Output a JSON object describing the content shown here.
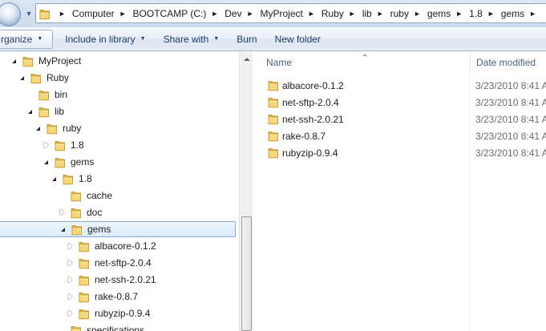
{
  "address_bar": {
    "breadcrumbs": [
      "Computer",
      "BOOTCAMP (C:)",
      "Dev",
      "MyProject",
      "Ruby",
      "lib",
      "ruby",
      "gems",
      "1.8",
      "gems"
    ]
  },
  "toolbar": {
    "organize_label": "rganize",
    "include_label": "Include in library",
    "share_label": "Share with",
    "burn_label": "Burn",
    "new_folder_label": "New folder"
  },
  "nav_tree": [
    {
      "label": "MyProject",
      "level": 1,
      "expander": "open"
    },
    {
      "label": "Ruby",
      "level": 2,
      "expander": "open"
    },
    {
      "label": "bin",
      "level": 3,
      "expander": "none"
    },
    {
      "label": "lib",
      "level": 3,
      "expander": "open"
    },
    {
      "label": "ruby",
      "level": 4,
      "expander": "open"
    },
    {
      "label": "1.8",
      "level": 5,
      "expander": "closed"
    },
    {
      "label": "gems",
      "level": 5,
      "expander": "open"
    },
    {
      "label": "1.8",
      "level": 6,
      "expander": "open"
    },
    {
      "label": "cache",
      "level": 7,
      "expander": "none"
    },
    {
      "label": "doc",
      "level": 7,
      "expander": "closed"
    },
    {
      "label": "gems",
      "level": 7,
      "expander": "open",
      "selected": true
    },
    {
      "label": "albacore-0.1.2",
      "level": 8,
      "expander": "closed"
    },
    {
      "label": "net-sftp-2.0.4",
      "level": 8,
      "expander": "closed"
    },
    {
      "label": "net-ssh-2.0.21",
      "level": 8,
      "expander": "closed"
    },
    {
      "label": "rake-0.8.7",
      "level": 8,
      "expander": "closed"
    },
    {
      "label": "rubyzip-0.9.4",
      "level": 8,
      "expander": "closed"
    },
    {
      "label": "specifications",
      "level": 7,
      "expander": "none"
    }
  ],
  "file_list": {
    "columns": {
      "name": "Name",
      "date": "Date modified"
    },
    "rows": [
      {
        "name": "albacore-0.1.2",
        "date": "3/23/2010 8:41 A"
      },
      {
        "name": "net-sftp-2.0.4",
        "date": "3/23/2010 8:41 A"
      },
      {
        "name": "net-ssh-2.0.21",
        "date": "3/23/2010 8:41 A"
      },
      {
        "name": "rake-0.8.7",
        "date": "3/23/2010 8:41 A"
      },
      {
        "name": "rubyzip-0.9.4",
        "date": "3/23/2010 8:41 A"
      }
    ]
  },
  "colors": {
    "toolbar_text": "#1e3b69",
    "selection_border": "#84acdd",
    "folder_yellow": "#f1cf6a"
  }
}
